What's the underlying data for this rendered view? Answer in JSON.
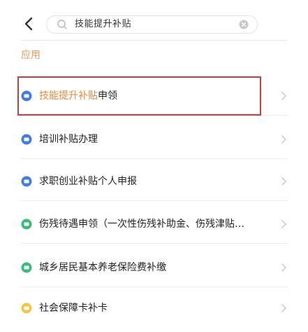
{
  "search": {
    "query": "技能提升补贴"
  },
  "section": {
    "title": "应用"
  },
  "results": [
    {
      "highlight": "技能提升补贴",
      "rest": "申领",
      "icon": "blue-circle-icon",
      "color": "#3f7de0"
    },
    {
      "highlight": "",
      "rest": "培训补贴办理",
      "icon": "blue-circle-icon",
      "color": "#3f7de0"
    },
    {
      "highlight": "",
      "rest": "求职创业补贴个人申报",
      "icon": "blue-circle-icon",
      "color": "#3f7de0"
    },
    {
      "highlight": "",
      "rest": "伤残待遇申领（一次性伤残补助金、伤残津贴…",
      "icon": "green-circle-icon",
      "color": "#3aba7c"
    },
    {
      "highlight": "",
      "rest": "城乡居民基本养老保险费补缴",
      "icon": "green-circle-icon",
      "color": "#3aba7c"
    },
    {
      "highlight": "",
      "rest": "社会保障卡补卡",
      "icon": "yellow-circle-icon",
      "color": "#f2c542"
    }
  ],
  "colors": {
    "accent": "#e68a3e",
    "section_label": "#e69a5a",
    "highlight_border": "#d7373f"
  }
}
